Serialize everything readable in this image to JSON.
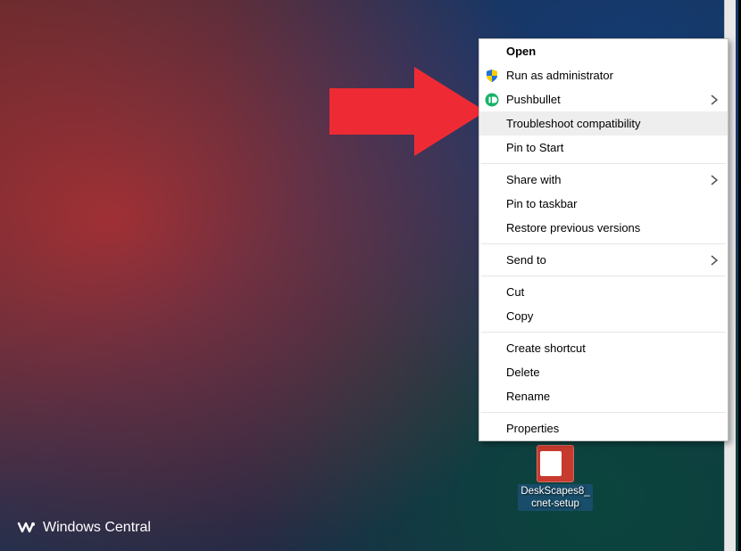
{
  "watermark": {
    "text": "Windows Central"
  },
  "desktop_icon": {
    "label_line1": "DeskScapes8_",
    "label_line2": "cnet-setup"
  },
  "context_menu": {
    "open": "Open",
    "run_admin": "Run as administrator",
    "pushbullet": "Pushbullet",
    "troubleshoot": "Troubleshoot compatibility",
    "pin_start": "Pin to Start",
    "share_with": "Share with",
    "pin_taskbar": "Pin to taskbar",
    "restore": "Restore previous versions",
    "send_to": "Send to",
    "cut": "Cut",
    "copy": "Copy",
    "create_shortcut": "Create shortcut",
    "delete": "Delete",
    "rename": "Rename",
    "properties": "Properties"
  }
}
